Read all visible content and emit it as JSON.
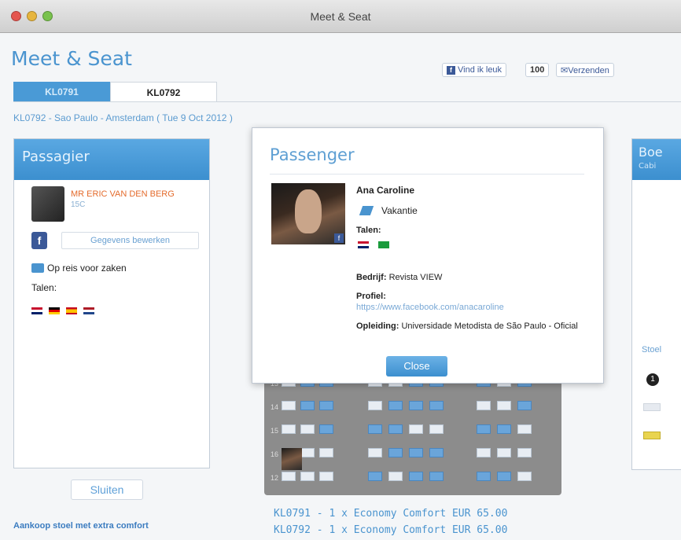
{
  "window": {
    "title": "Meet & Seat"
  },
  "app": {
    "title": "Meet & Seat"
  },
  "social": {
    "like": "Vind ik leuk",
    "count": "100",
    "send": "Verzenden"
  },
  "tabs": [
    {
      "label": "KL0791"
    },
    {
      "label": "KL0792"
    }
  ],
  "route": "KL0792 - Sao Paulo - Amsterdam ( Tue 9 Oct 2012 )",
  "left": {
    "header": "Passagier",
    "name": "MR ERIC VAN DEN BERG",
    "sub": "15C",
    "edit": "Gegevens bewerken",
    "business": "Op reis voor zaken",
    "languages_label": "Talen:",
    "close": "Sluiten",
    "extra": "Aankoop stoel met extra comfort"
  },
  "right": {
    "header": "Boe",
    "sub": "Cabi",
    "link": "Stoel"
  },
  "modal": {
    "title": "Passenger",
    "name": "Ana Caroline",
    "purpose": "Vakantie",
    "languages_label": "Talen:",
    "company_label": "Bedrijf:",
    "company": "Revista VIEW",
    "profile_label": "Profiel:",
    "profile_url": "https://www.facebook.com/anacaroline",
    "education_label": "Opleiding:",
    "education": "Universidade Metodista de São Paulo - Oficial",
    "close": "Close"
  },
  "seatmap": {
    "rows": [
      "12",
      "13",
      "14",
      "15",
      "16"
    ]
  },
  "bookings": [
    "KL0791 - 1 x Economy Comfort EUR 65.00",
    "KL0792 - 1 x Economy Comfort EUR 65.00"
  ],
  "colors": {
    "accent": "#4a94cf",
    "name_orange": "#e46b2c",
    "facebook": "#3b5998"
  }
}
